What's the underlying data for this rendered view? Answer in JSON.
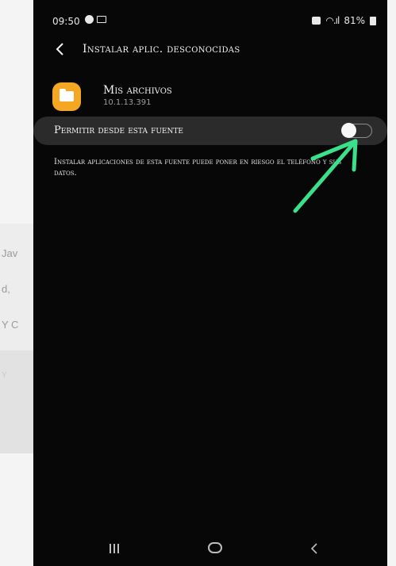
{
  "background": {
    "fragments": [
      "Jav",
      "d,",
      "Y C",
      "Y"
    ]
  },
  "status_bar": {
    "time": "09:50",
    "icons_left": [
      "notification-dot-icon",
      "image-icon"
    ],
    "icons_right": [
      "alarm-icon",
      "wifi-icon",
      "signal-icon",
      "battery-icon"
    ],
    "battery": "81%"
  },
  "header": {
    "back_icon": "chevron-left-icon",
    "title": "Instalar aplic. desconocidas"
  },
  "app": {
    "icon": "folder-icon",
    "name": "Mis archivos",
    "version": "10.1.13.391"
  },
  "toggle": {
    "label": "Permitir desde esta fuente",
    "state": "off"
  },
  "warning": "Instalar aplicaciones de esta fuente puede poner en riesgo el teléfono y sus datos.",
  "annotation": {
    "arrow_color": "#3be08a"
  },
  "nav_bar": {
    "items": [
      "recents-icon",
      "home-icon",
      "back-icon"
    ]
  },
  "colors": {
    "screen_bg": "#070707",
    "row_bg": "#2b2b2b",
    "app_icon": "#f5a623"
  }
}
